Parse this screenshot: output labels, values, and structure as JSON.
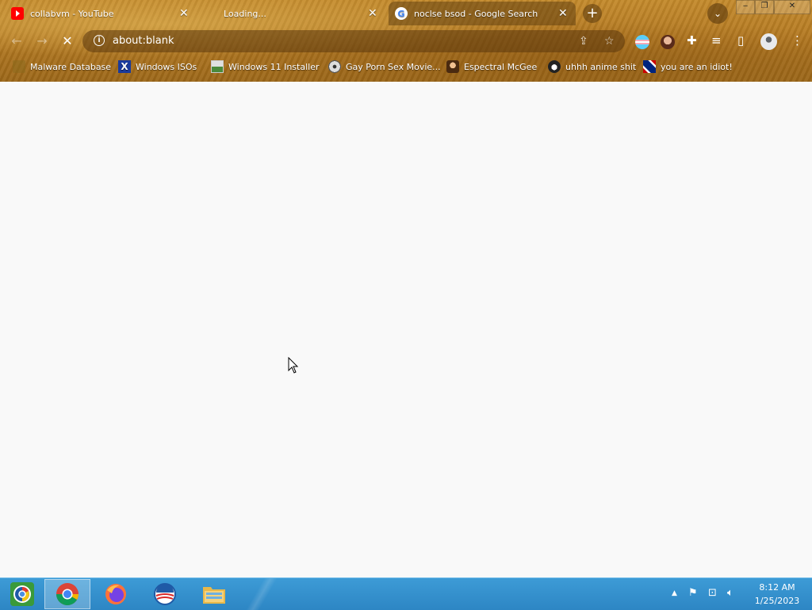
{
  "tabs": [
    {
      "title": "collabvm - YouTube",
      "favicon": "youtube-icon"
    },
    {
      "title": "Loading...",
      "favicon": "none"
    },
    {
      "title": "noclse bsod - Google Search",
      "favicon": "google-icon",
      "active": true
    }
  ],
  "omnibox": {
    "url": "about:blank"
  },
  "bookmarks": [
    {
      "label": "Malware Database",
      "icon": "folder-icon"
    },
    {
      "label": "Windows ISOs",
      "icon": "x-icon"
    },
    {
      "label": "Windows 11 Installer",
      "icon": "image-icon"
    },
    {
      "label": "Gay Porn Sex Movie...",
      "icon": "cd-icon"
    },
    {
      "label": "Espectral McGee",
      "icon": "character-icon"
    },
    {
      "label": "uhhh anime shit",
      "icon": "anime-icon"
    },
    {
      "label": "you are an idiot!",
      "icon": "flag-icon"
    }
  ],
  "taskbar": {
    "apps": [
      "start-orb",
      "chrome",
      "firefox",
      "obama-app",
      "file-explorer"
    ],
    "active_app": "chrome"
  },
  "clock": {
    "time": "8:12 AM",
    "date": "1/25/2023"
  },
  "colors": {
    "chrome_bg": "#b57a22",
    "taskbar": "#2d86c4",
    "content_bg": "#f9f9f9"
  }
}
